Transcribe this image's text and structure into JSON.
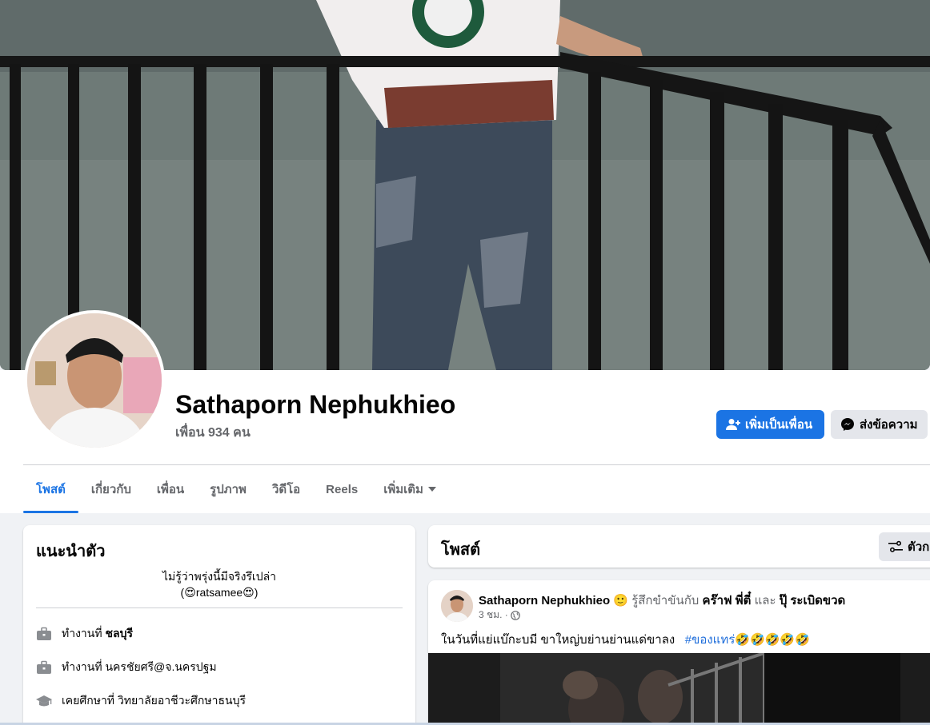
{
  "profile": {
    "name": "Sathaporn Nephukhieo",
    "friends_label": "เพื่อน 934 คน"
  },
  "actions": {
    "add_friend": "เพิ่มเป็นเพื่อน",
    "message": "ส่งข้อความ"
  },
  "tabs": [
    {
      "label": "โพสต์",
      "active": true
    },
    {
      "label": "เกี่ยวกับ"
    },
    {
      "label": "เพื่อน"
    },
    {
      "label": "รูปภาพ"
    },
    {
      "label": "วิดีโอ"
    },
    {
      "label": "Reels"
    },
    {
      "label": "เพิ่มเติม"
    }
  ],
  "intro": {
    "title": "แนะนำตัว",
    "bio_line1": "ไม่รู้ว่าพรุ่งนี้มีจริงรึเปล่า",
    "bio_line2_prefix": "(",
    "bio_line2_name": "ratsamee",
    "bio_line2_suffix": ")",
    "rows": [
      {
        "icon": "briefcase-icon",
        "prefix": "ทำงานที่ ",
        "value": "ชลบุรี",
        "value_bold": true
      },
      {
        "icon": "briefcase-icon",
        "prefix": "ทำงานที่ ",
        "value": "นครชัยศรี@จ.นครปฐม",
        "value_bold": false
      },
      {
        "icon": "graduation-cap-icon",
        "prefix": "เคยศึกษาที่ ",
        "value": "วิทยาลัยอาชีวะศึกษาธนบุรี",
        "value_bold": false
      }
    ]
  },
  "posts_header": {
    "title": "โพสต์",
    "filter_label": "ตัวก"
  },
  "post": {
    "author": "Sathaporn Nephukhieo",
    "feeling": "รู้สึกขำขันกับ",
    "tag1": "คร๊าฟ พี่ตี๋",
    "and": "และ",
    "tag2": "ปุ๊ ระเบิดขวด",
    "time": "3 ชม. ·",
    "text": "ในวันที่แย่แบ๊กะบมี ขาใหญ่บย่านย่านแด่ขาลง",
    "hashtag": "#ของแทร่",
    "emoji": "🤣🤣🤣🤣🤣"
  },
  "colors": {
    "accent": "#1b74e4",
    "page_bg": "#f0f2f5",
    "secondary_text": "#65676b"
  }
}
